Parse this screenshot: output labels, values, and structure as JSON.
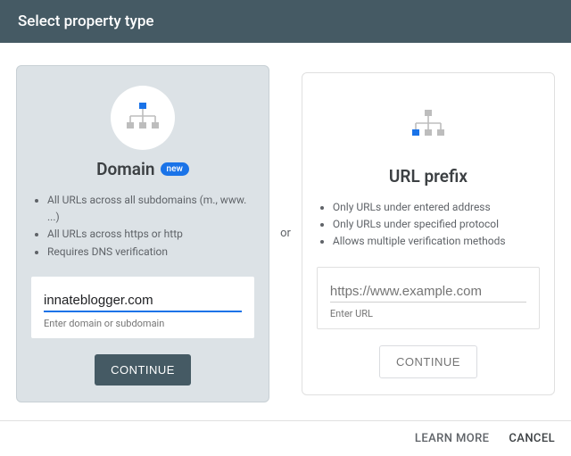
{
  "header": {
    "title": "Select property type"
  },
  "separator": "or",
  "domain": {
    "title": "Domain",
    "badge": "new",
    "bullets": [
      "All URLs across all subdomains (m., www. ...)",
      "All URLs across https or http",
      "Requires DNS verification"
    ],
    "input_value": "innateblogger.com",
    "input_helper": "Enter domain or subdomain",
    "continue_label": "CONTINUE"
  },
  "url": {
    "title": "URL prefix",
    "bullets": [
      "Only URLs under entered address",
      "Only URLs under specified protocol",
      "Allows multiple verification methods"
    ],
    "input_placeholder": "https://www.example.com",
    "input_helper": "Enter URL",
    "continue_label": "CONTINUE"
  },
  "footer": {
    "learn_more": "LEARN MORE",
    "cancel": "CANCEL"
  },
  "colors": {
    "accent": "#1a73e8",
    "header": "#455a64"
  }
}
